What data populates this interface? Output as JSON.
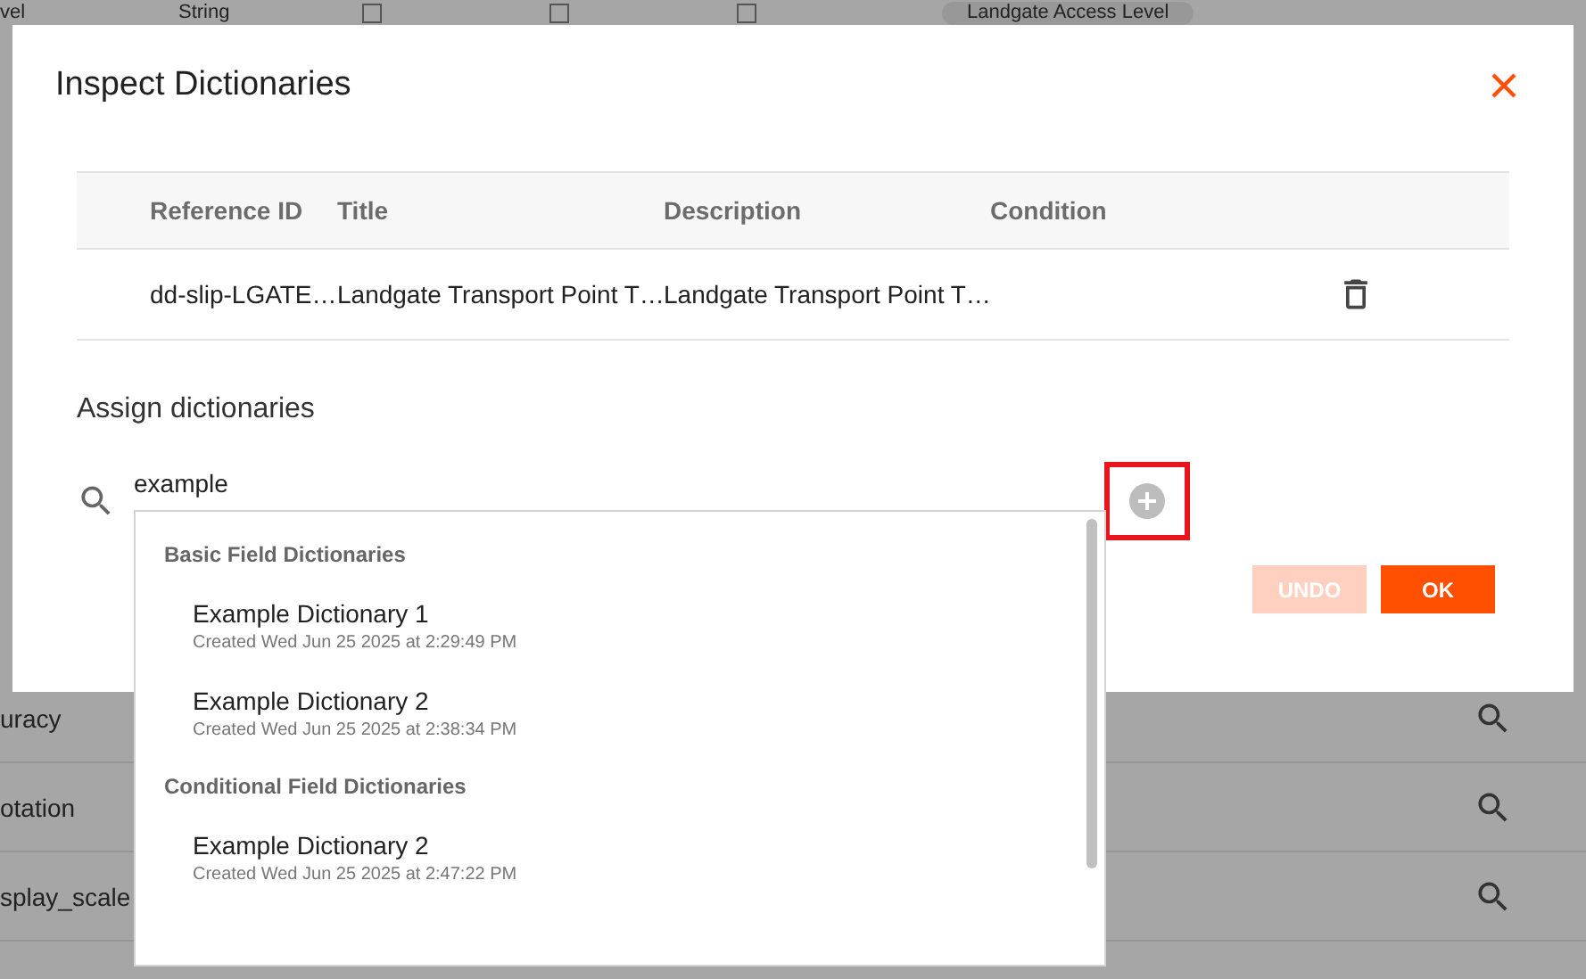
{
  "background_table": {
    "top_row": {
      "name": "vel",
      "type": "String",
      "checkboxes": [
        {
          "checked": false
        },
        {
          "checked": false
        },
        {
          "checked": false
        }
      ],
      "chip": "Landgate Access Level"
    },
    "rows": [
      {
        "name": "uracy"
      },
      {
        "name": "otation"
      },
      {
        "name": "splay_scale"
      }
    ]
  },
  "dialog": {
    "title": "Inspect Dictionaries",
    "table": {
      "columns": [
        "Reference ID",
        "Title",
        "Description",
        "Condition"
      ],
      "rows": [
        {
          "cells": [
            "dd-slip-LGATE…",
            "Landgate Transport Point T…",
            "Landgate Transport Point T…",
            ""
          ]
        }
      ]
    },
    "assign": {
      "heading": "Assign dictionaries",
      "search": {
        "value": "example"
      },
      "add_button": {
        "highlighted": true,
        "disabled": true
      },
      "dropdown": {
        "groups": [
          {
            "title": "Basic Field Dictionaries",
            "items": [
              {
                "name": "Example Dictionary 1",
                "created": "Created Wed Jun 25 2025 at 2:29:49 PM"
              },
              {
                "name": "Example Dictionary 2",
                "created": "Created Wed Jun 25 2025 at 2:38:34 PM"
              }
            ]
          },
          {
            "title": "Conditional Field Dictionaries",
            "items": [
              {
                "name": "Example Dictionary 2",
                "created": "Created Wed Jun 25 2025 at 2:47:22 PM"
              }
            ]
          }
        ]
      }
    },
    "buttons": [
      {
        "label": "UNDO",
        "disabled": true
      },
      {
        "label": "OK",
        "disabled": false
      }
    ]
  }
}
